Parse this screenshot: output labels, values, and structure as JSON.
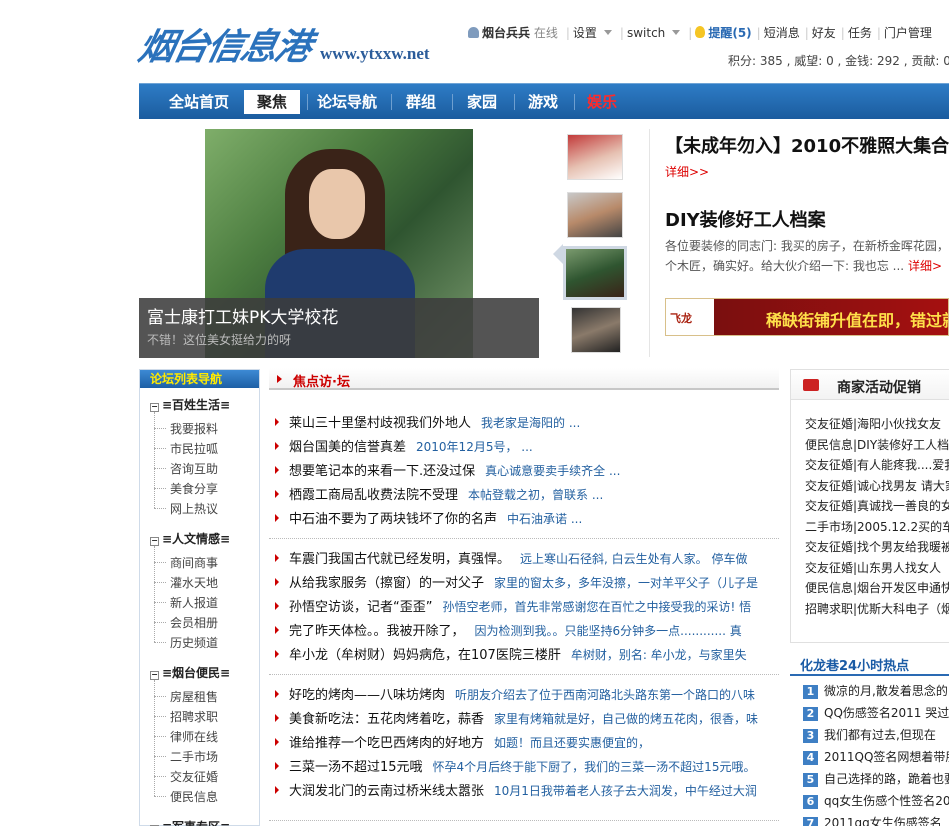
{
  "site": {
    "logo_text": "烟台信息港",
    "logo_url": "www.ytxxw.net"
  },
  "userbar": {
    "username": "烟台兵兵",
    "status": "在线",
    "settings": "设置",
    "switch": "switch",
    "remind": "提醒(5)",
    "messages": "短消息",
    "friends": "好友",
    "tasks": "任务",
    "portal_admin": "门户管理"
  },
  "credits": "积分: 385 , 威望: 0 , 金钱: 292 , 贡献: 0",
  "nav": {
    "items": [
      "全站首页",
      "聚焦",
      "论坛导航",
      "群组",
      "家园",
      "游戏",
      "娱乐"
    ],
    "active_index": 1,
    "highlight_index": 6
  },
  "slideshow": {
    "caption_title": "富士康打工妹PK大学校花",
    "caption_sub": "不错！这位美女挺给力的呀",
    "thumbs": [
      "thumb-1",
      "thumb-2",
      "thumb-3",
      "thumb-4"
    ],
    "selected_thumb": 2
  },
  "headlines": {
    "h1_title": "【未成年勿入】2010不雅照大集合",
    "h1_more": "详细>>",
    "h2_title": "DIY装修好工人档案",
    "h2_desc": "各位要装修的同志门:  我买的房子，在新桥金晖花园，个木匠，确实好。给大伙介绍一下:  我也忘 ...",
    "h2_more": "详细>"
  },
  "banner": {
    "brand": "飞龙 ",
    "text": "稀缺街铺升值在即，错过就后"
  },
  "leftnav": {
    "title": "论坛列表导航",
    "groups": [
      {
        "name": "≡百姓生活≡",
        "items": [
          "我要报料",
          "市民拉呱",
          "咨询互助",
          "美食分享",
          "网上热议"
        ]
      },
      {
        "name": "≡人文情感≡",
        "items": [
          "商间商事",
          "灌水天地",
          "新人报道",
          "会员相册",
          "历史频道"
        ]
      },
      {
        "name": "≡烟台便民≡",
        "items": [
          "房屋租售",
          "招聘求职",
          "律师在线",
          "二手市场",
          "交友征婚",
          "便民信息"
        ]
      },
      {
        "name": "≡军事专区≡",
        "items": []
      }
    ]
  },
  "focus": {
    "title": "焦点访·坛",
    "groups": [
      [
        {
          "title": "莱山三十里堡村歧视我们外地人",
          "desc": "我老家是海阳的 ..."
        },
        {
          "title": "烟台国美的信誉真差",
          "desc": "2010年12月5号， ..."
        },
        {
          "title": "想要笔记本的来看一下.还没过保",
          "desc": "真心诚意要卖手续齐全 ..."
        },
        {
          "title": "栖霞工商局乱收费法院不受理",
          "desc": "本帖登载之初，曾联系 ..."
        },
        {
          "title": "中石油不要为了两块钱坏了你的名声",
          "desc": "中石油承诺 ..."
        }
      ],
      [
        {
          "title": "车震门我国古代就已经发明，真强悍。",
          "desc": "远上寒山石径斜, 白云生处有人家。 停车做"
        },
        {
          "title": "从给我家服务（擦窗）的一对父子",
          "desc": "家里的窗太多，多年没擦，一对羊平父子（儿子是"
        },
        {
          "title": "孙悟空访谈，记者“歪歪”",
          "desc": "孙悟空老师，首先非常感谢您在百忙之中接受我的采访! 悟"
        },
        {
          "title": "完了昨天体检。。我被开除了，",
          "desc": "因为检测到我。。只能坚持6分钟多一点............ 真"
        },
        {
          "title": "牟小龙（牟树财）妈妈病危，在107医院三楼肝",
          "desc": "牟树财，别名: 牟小龙，与家里失"
        }
      ],
      [
        {
          "title": "好吃的烤肉——八味坊烤肉",
          "desc": "听朋友介绍去了位于西南河路北头路东第一个路口的八味"
        },
        {
          "title": "美食新吃法：五花肉烤着吃，蒜香",
          "desc": "家里有烤箱就是好，自己做的烤五花肉，很香，味"
        },
        {
          "title": "谁给推荐一个吃巴西烤肉的好地方",
          "desc": "如题！而且还要实惠便宜的，"
        },
        {
          "title": "三菜一汤不超过15元哦",
          "desc": "怀孕4个月后终于能下厨了，我们的三菜一汤不超过15元哦。"
        },
        {
          "title": "大润发北门的云南过桥米线太嚣张",
          "desc": "10月1日我带着老人孩子去大润发，中午经过大润"
        }
      ]
    ]
  },
  "promo": {
    "title": "商家活动促销",
    "items": [
      "交友征婚|海阳小伙找女友",
      "便民信息|DIY装修好工人档案",
      "交友征婚|有人能疼我....爱我",
      "交友征婚|诚心找男友 请大家",
      "交友征婚|真诚找一善良的女",
      "二手市场|2005.12.2买的车",
      "交友征婚|找个男友给我暖被",
      "交友征婚|山东男人找女人",
      "便民信息|烟台开发区申通快",
      "招聘求职|优斯大科电子（烟"
    ]
  },
  "hot": {
    "title": "化龙巷24小时热点",
    "items": [
      "微凉的月,散发着思念的",
      "QQ伤感签名2011 哭过",
      "我们都有过去,但现在",
      "2011QQ签名网想着带朋",
      "自己选择的路，跪着也要",
      "qq女生伤感个性签名20",
      "2011qq女生伤感签名"
    ]
  }
}
